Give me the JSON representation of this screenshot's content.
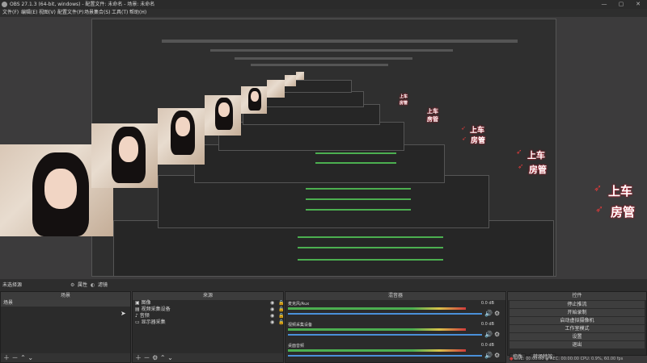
{
  "window": {
    "title": "OBS 27.1.3 (64-bit, windows) - 配置文件: 未命名 - 场景: 未命名",
    "controls": [
      "—",
      "▢",
      "✕"
    ]
  },
  "menu": [
    "文件(F)",
    "编辑(E)",
    "视图(V)",
    "配置文件(P)",
    "场景集合(S)",
    "工具(T)",
    "帮助(H)"
  ],
  "scenebar": {
    "label": "未选择源",
    "properties": "属性",
    "filters": "滤镜"
  },
  "scenes": {
    "title": "场景",
    "items": [
      "场景"
    ]
  },
  "sources": {
    "title": "来源",
    "items": [
      {
        "name": "图像",
        "icon": "image-icon"
      },
      {
        "name": "视频采集设备",
        "icon": "camera-icon"
      },
      {
        "name": "音频",
        "icon": "speaker-icon"
      },
      {
        "name": "显示器采集",
        "icon": "monitor-icon"
      }
    ]
  },
  "mixer": {
    "title": "混音器",
    "channels": [
      {
        "name": "麦克风/Aux",
        "db": "0.0 dB"
      },
      {
        "name": "视频采集设备",
        "db": "0.0 dB"
      },
      {
        "name": "桌面音频",
        "db": "0.0 dB"
      }
    ]
  },
  "controls": {
    "title": "控件",
    "buttons": [
      "停止推流",
      "开始录制",
      "启动虚拟摄像机",
      "工作室模式",
      "设置",
      "退出"
    ],
    "tabs": [
      "控件",
      "转场特效"
    ]
  },
  "status": {
    "live": "LIVE: 00:00:00",
    "rec": "REC: 00:00:00",
    "cpu": "CPU: 0.9%, 60.00 fps"
  },
  "stickers": {
    "line1": "上车",
    "line2": "房管"
  },
  "colors": {
    "accent": "#4a90d9",
    "meter_green": "#4caf50",
    "meter_yellow": "#d8c24a",
    "meter_red": "#d23c3c"
  }
}
